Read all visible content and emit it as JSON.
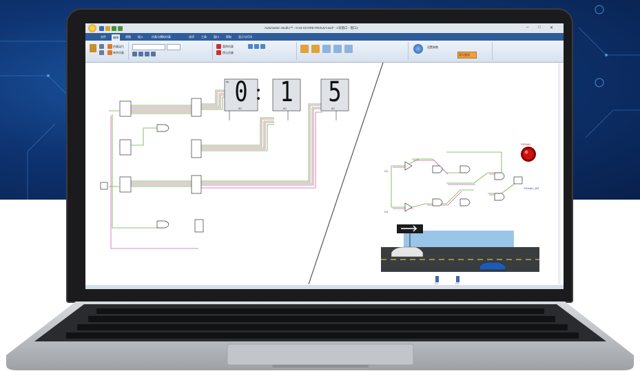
{
  "window": {
    "title": "Automation Studio™ - 0-15-SCORE-RESULT.asd* - 1号窗口 - 窗口1",
    "controls": [
      "–",
      "□",
      "✕"
    ]
  },
  "ribbon": {
    "tabs": [
      "文件",
      "编辑",
      "视图",
      "插入",
      "仿真与模拟仿真",
      "选项",
      "工具",
      "窗口",
      "帮助",
      "显示与打印"
    ],
    "active_tab_index": 1,
    "buttons": [
      "仿真运行",
      "单步仿真",
      "暂停仿真",
      "停止仿真",
      "设置参数",
      "显示变化"
    ]
  },
  "counter": {
    "digits": [
      "0",
      "1",
      "5"
    ],
    "separator": ":",
    "digit_labels": [
      "0C",
      "0C",
      "0C"
    ],
    "pin_top_label": "dp"
  },
  "traffic": {
    "lamp_label": "SIGNAL",
    "sensor_labels": [
      "C1",
      "C2"
    ],
    "bottom_sensors": [
      "C1",
      "C2"
    ],
    "output_label": "SIGNAL_BIT"
  },
  "colors": {
    "screen_bg": "#ffffff",
    "wire_green": "#62b33f",
    "wire_pink": "#d45fb0",
    "lamp_red": "#cc1010",
    "road": "#3a3d40"
  },
  "icons": [
    "app-logo-icon",
    "arrow-right-sign-icon",
    "car-icon",
    "lamp-icon"
  ]
}
